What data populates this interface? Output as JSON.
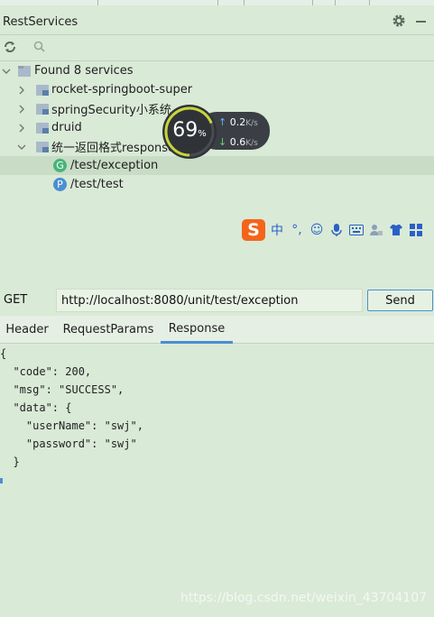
{
  "window": {
    "title": "RestServices"
  },
  "header": {
    "settings_icon": "gear-icon",
    "minimize_icon": "minimize-icon"
  },
  "toolbar": {
    "refresh_icon": "refresh-icon",
    "search_icon": "search-icon"
  },
  "tree": {
    "root": {
      "label": "Found 8 services"
    },
    "modules": [
      {
        "label": "rocket-springboot-super"
      },
      {
        "label": "springSecurity小系统"
      },
      {
        "label": "druid"
      },
      {
        "label": "统一返回格式response"
      }
    ],
    "endpoints": [
      {
        "badge": "G",
        "label": "/test/exception",
        "color": "#47b47a",
        "selected": true
      },
      {
        "badge": "P",
        "label": "/test/test",
        "color": "#4a8fd1",
        "selected": false
      }
    ]
  },
  "speed_widget": {
    "percent": "69",
    "percent_unit": "%",
    "upload": "0.2",
    "download": "0.6",
    "unit": "K/s"
  },
  "ime": {
    "logo": "S",
    "items": [
      "中",
      "°,",
      "☺",
      "mic-icon",
      "keyboard-icon",
      "user-icon",
      "shirt-icon",
      "grid-icon"
    ]
  },
  "request": {
    "method": "GET",
    "url": "http://localhost:8080/unit/test/exception",
    "send_label": "Send"
  },
  "tabs": [
    {
      "label": "Header"
    },
    {
      "label": "RequestParams"
    },
    {
      "label": "Response",
      "active": true
    }
  ],
  "response": {
    "lines": [
      "{",
      "  \"code\": 200,",
      "  \"msg\": \"SUCCESS\",",
      "  \"data\": {",
      "    \"userName\": \"swj\",",
      "    \"password\": \"swj\"",
      "  }",
      ""
    ]
  },
  "watermark": "https://blog.csdn.net/weixin_43704107",
  "colors": {
    "accent": "#4a8fd1",
    "background": "#d9ead7",
    "get_badge": "#47b47a",
    "post_badge": "#4a8fd1"
  }
}
